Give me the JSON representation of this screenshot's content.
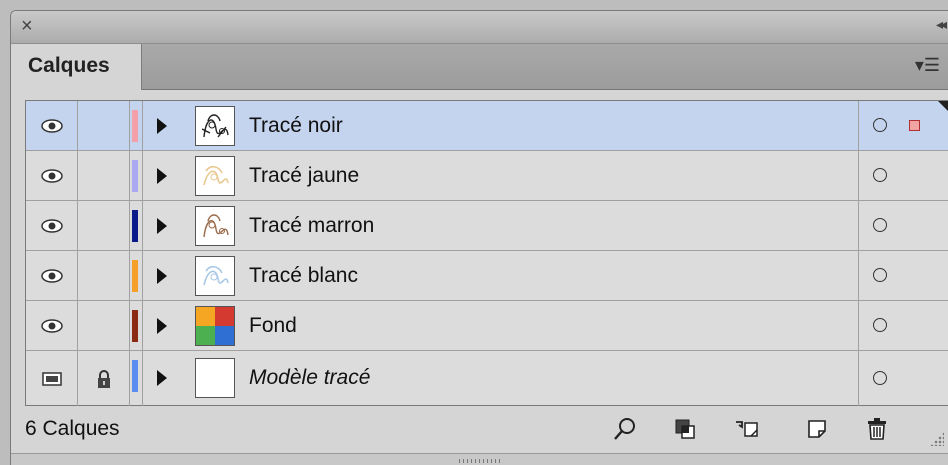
{
  "panel": {
    "tab_label": "Calques",
    "close_icon": "close-icon",
    "collapse_icon": "double-chevron-right-icon",
    "menu_icon": "panel-menu-icon"
  },
  "layers": [
    {
      "name": "Tracé noir",
      "color": "#f4a0a8",
      "visible": true,
      "locked": false,
      "selected": true,
      "italic": false,
      "thumb": "trace-noir-thumbnail"
    },
    {
      "name": "Tracé jaune",
      "color": "#a9a8f0",
      "visible": true,
      "locked": false,
      "selected": false,
      "italic": false,
      "thumb": "trace-jaune-thumbnail"
    },
    {
      "name": "Tracé marron",
      "color": "#0b1a8a",
      "visible": true,
      "locked": false,
      "selected": false,
      "italic": false,
      "thumb": "trace-marron-thumbnail"
    },
    {
      "name": "Tracé blanc",
      "color": "#f5a02a",
      "visible": true,
      "locked": false,
      "selected": false,
      "italic": false,
      "thumb": "trace-blanc-thumbnail"
    },
    {
      "name": "Fond",
      "color": "#8a2a12",
      "visible": true,
      "locked": false,
      "selected": false,
      "italic": false,
      "thumb": "fond-thumbnail"
    },
    {
      "name": "Modèle tracé",
      "color": "#5b8cf0",
      "visible": false,
      "locked": true,
      "selected": false,
      "italic": true,
      "thumb": "blank-thumbnail"
    }
  ],
  "footer": {
    "layer_count": "6 Calques",
    "icons": [
      "search-icon",
      "make-clipping-mask-icon",
      "create-sublayer-icon",
      "new-layer-icon",
      "trash-icon"
    ]
  },
  "colors": {
    "selection": "#c4d4ee",
    "panel_bg": "#d5d5d5"
  }
}
